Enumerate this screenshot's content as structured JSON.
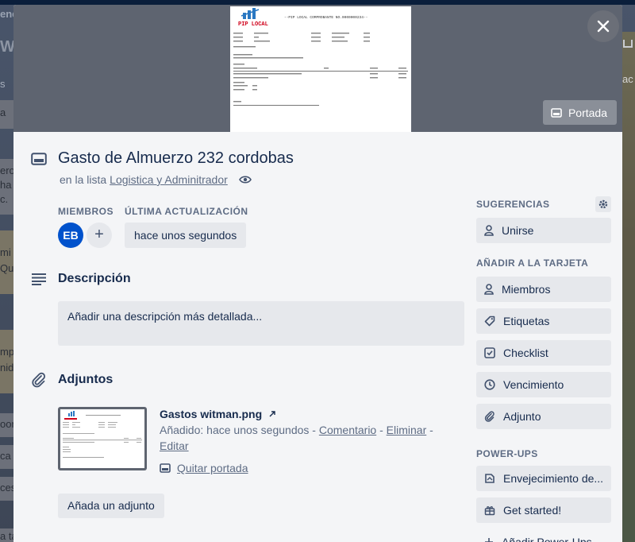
{
  "background": {
    "left_fragments": [
      "ene",
      "W",
      "s",
      "a",
      "ero,",
      "ha",
      "c.",
      "mi",
      "Qu",
      "mp",
      "nid",
      "oor",
      "ca",
      "ces",
      "a ta"
    ],
    "right_fragments": [
      "ac"
    ]
  },
  "cover": {
    "button_label": "Portada",
    "preview": {
      "brand": "PIP LOCAL",
      "heading": "--PIP LOCAL COMPROBANTE NO.0000000234--"
    }
  },
  "card": {
    "title": "Gasto de Almuerzo 232 cordobas",
    "list_prefix": "en la lista",
    "list_name": "Logistica y Adminitrador"
  },
  "members": {
    "label": "MIEMBROS",
    "avatars": [
      "EB"
    ],
    "add_symbol": "+"
  },
  "last_update": {
    "label": "ÚLTIMA ACTUALIZACIÓN",
    "value": "hace unos segundos"
  },
  "description": {
    "title": "Descripción",
    "placeholder": "Añadir una descripción más detallada..."
  },
  "attachments": {
    "title": "Adjuntos",
    "file_name": "Gastos witman.png",
    "added_prefix": "Añadido:",
    "added_time": "hace unos segundos",
    "comment": "Comentario",
    "delete": "Eliminar",
    "edit": "Editar",
    "separator": "-",
    "remove_cover": "Quitar portada",
    "add_button": "Añada un adjunto"
  },
  "sidebar": {
    "suggestions_label": "SUGERENCIAS",
    "join": "Unirse",
    "add_to_card_label": "AÑADIR A LA TARJETA",
    "items": [
      "Miembros",
      "Etiquetas",
      "Checklist",
      "Vencimiento",
      "Adjunto"
    ],
    "powerups_label": "POWER-UPS",
    "powerups": [
      "Envejecimiento de...",
      "Get started!"
    ],
    "add_powerups": "Añadir Power-Ups"
  }
}
